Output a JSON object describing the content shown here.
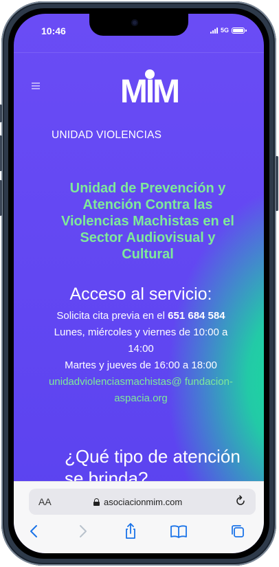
{
  "status_bar": {
    "time": "10:46",
    "network": "5G"
  },
  "header": {
    "logo_text": "MIM",
    "section_title": "UNIDAD VIOLENCIAS"
  },
  "main": {
    "heading": "Unidad de Prevención y Atención Contra las Violencias Machistas en el Sector Audiovisual y Cultural",
    "acceso_title": "Acceso al servicio:",
    "cita_prefix": "Solicita cita previa en el ",
    "phone": "651 684 584",
    "schedule_1": "Lunes, miércoles y viernes de 10:00 a 14:00",
    "schedule_2": "Martes y jueves de 16:00 a 18:00",
    "email": "unidadviolenciasmachistas@ fundacion-aspacia.org",
    "que_title": "¿Qué tipo de atención se brinda?"
  },
  "safari": {
    "aa_label": "AA",
    "url": "asociacionmim.com",
    "icons": [
      "back-icon",
      "forward-icon",
      "share-icon",
      "bookmarks-icon",
      "tabs-icon",
      "reload-icon"
    ]
  },
  "colors": {
    "accent_purple": "#5a42ef",
    "accent_green": "#7fe99a",
    "gradient_green": "#18e19a"
  }
}
